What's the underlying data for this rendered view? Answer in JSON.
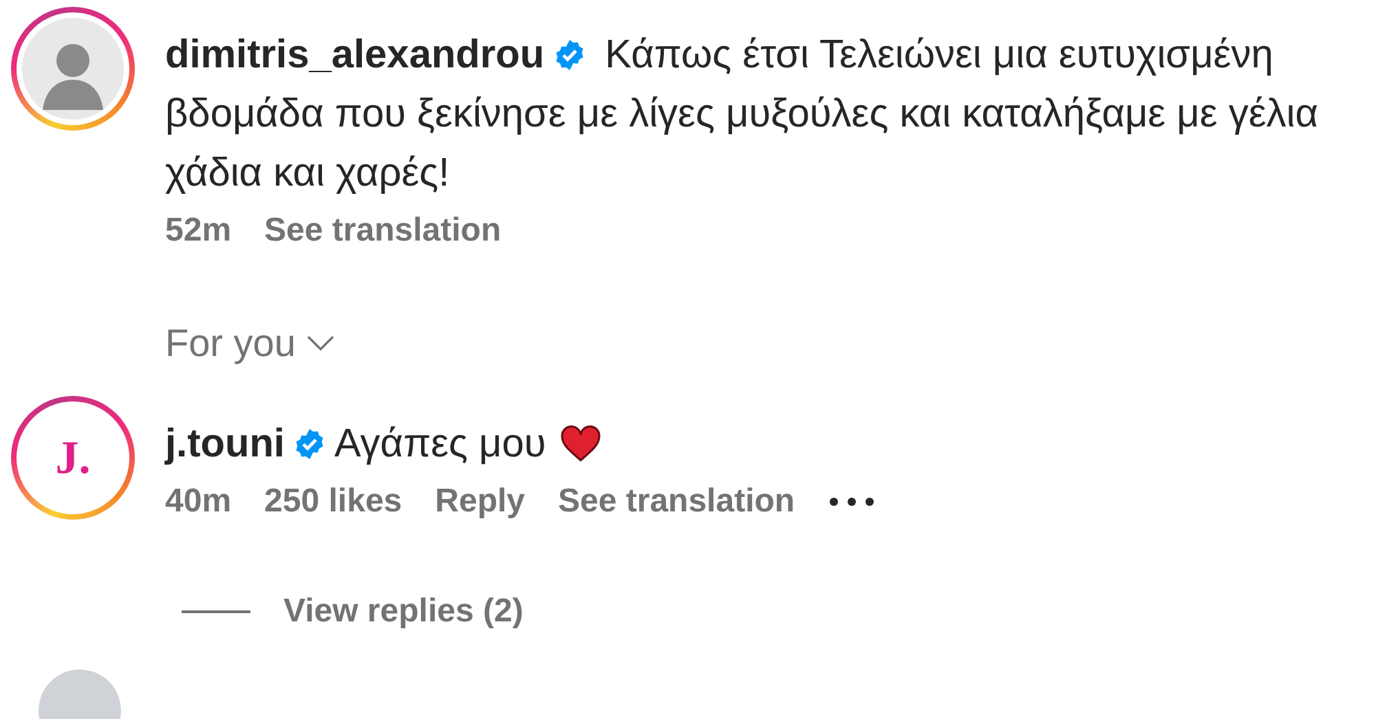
{
  "post": {
    "username": "dimitris_alexandrou",
    "verified": true,
    "caption": "Κάπως έτσι Τελειώνει μια ευτυχισμένη βδομάδα που ξεκίνησε με λίγες μυξούλες και καταλήξαμε με γέλια χάδια και χαρές!",
    "time": "52m",
    "translate": "See translation"
  },
  "sort": {
    "label": "For you"
  },
  "comments": [
    {
      "username": "j.touni",
      "avatar_text": "J.",
      "verified": true,
      "text": "Αγάπες μου",
      "heart": true,
      "time": "40m",
      "likes": "250 likes",
      "reply": "Reply",
      "translate": "See translation",
      "view_replies": "View replies (2)"
    }
  ]
}
